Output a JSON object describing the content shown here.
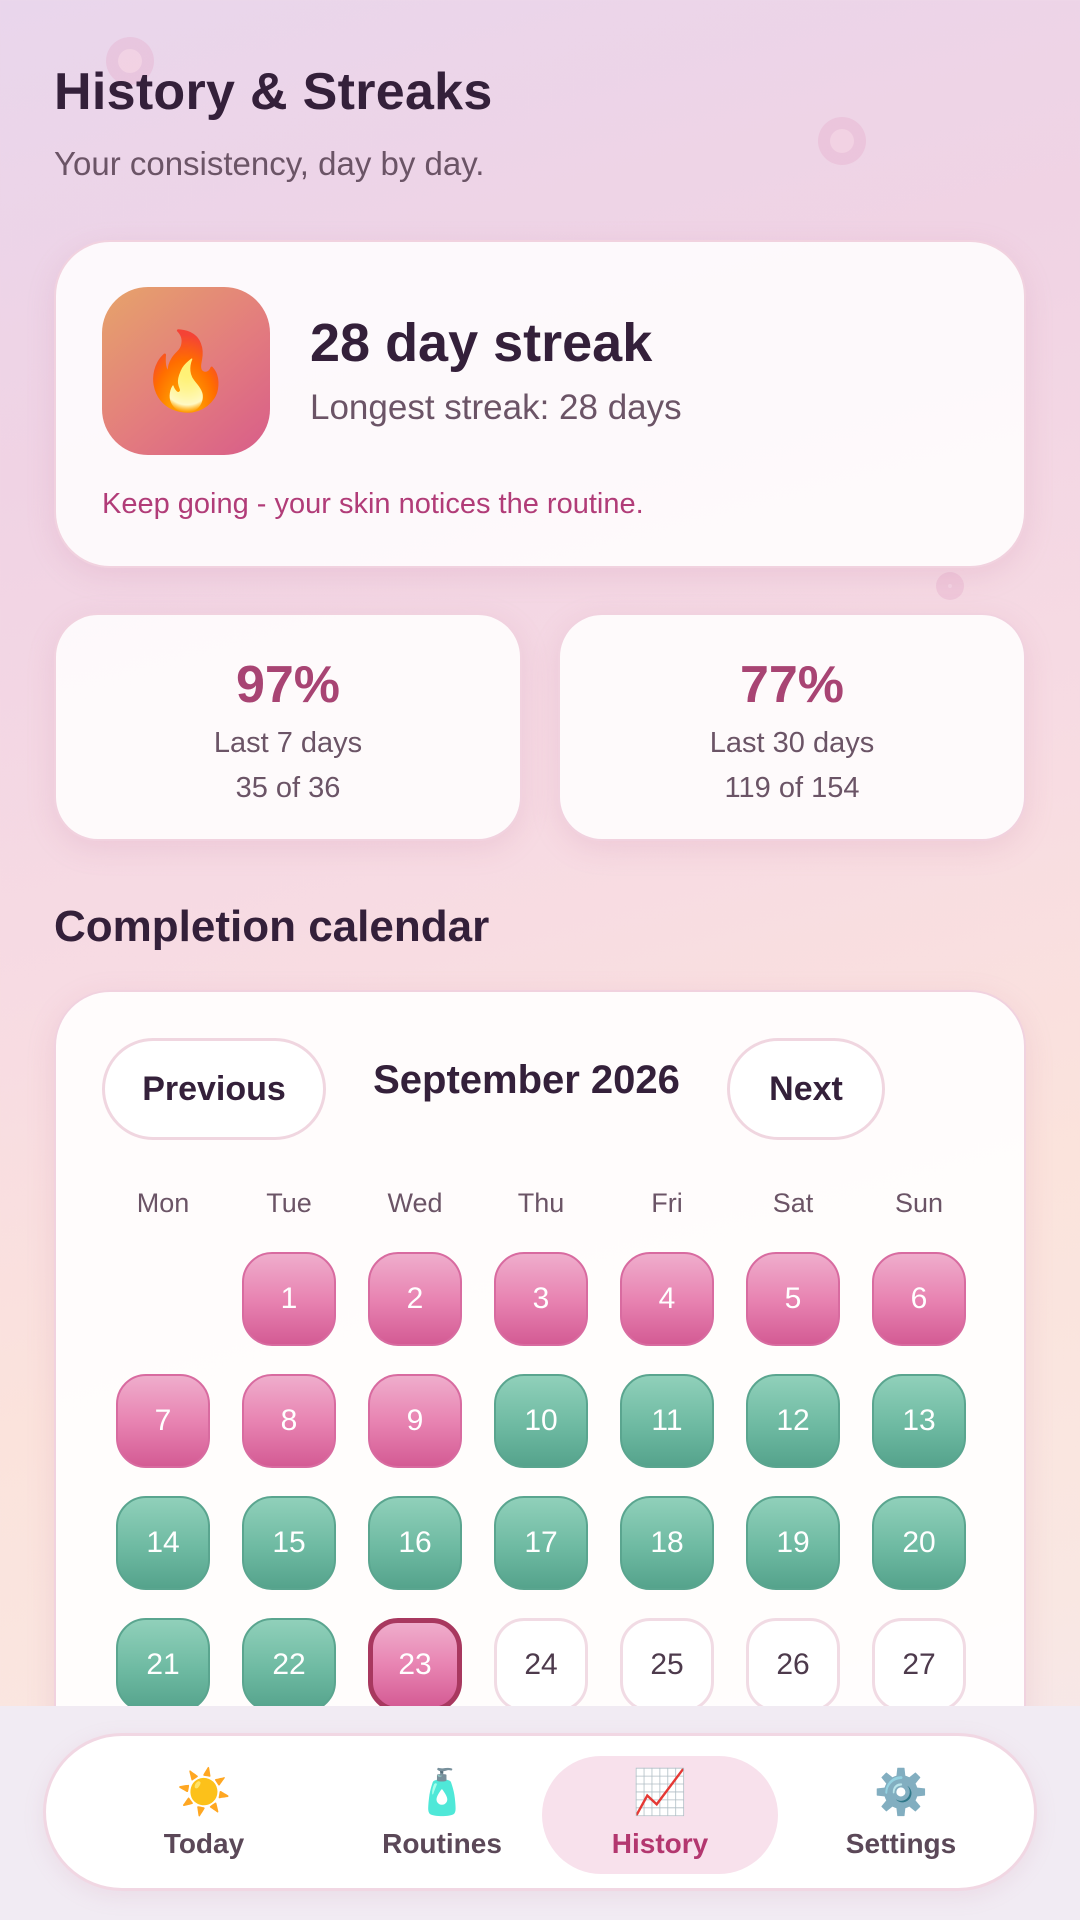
{
  "header": {
    "title": "History & Streaks",
    "subtitle": "Your consistency, day by day."
  },
  "streak": {
    "icon": "flame-icon",
    "icon_glyph": "🔥",
    "title": "28 day streak",
    "longest": "Longest streak: 28 days",
    "message": "Keep going - your skin notices the routine."
  },
  "stats": [
    {
      "percent": "97%",
      "label": "Last 7 days",
      "count": "35 of 36"
    },
    {
      "percent": "77%",
      "label": "Last 30 days",
      "count": "119 of 154"
    }
  ],
  "calendar": {
    "section_title": "Completion calendar",
    "prev_label": "Previous",
    "next_label": "Next",
    "month": "September 2026",
    "weekdays": [
      "Mon",
      "Tue",
      "Wed",
      "Thu",
      "Fri",
      "Sat",
      "Sun"
    ],
    "status_colors": {
      "partial": "#e884b2",
      "complete": "#6ebaa2",
      "pending": "#ffffff"
    },
    "days": [
      {
        "day": "1",
        "status": "partial"
      },
      {
        "day": "2",
        "status": "partial"
      },
      {
        "day": "3",
        "status": "partial"
      },
      {
        "day": "4",
        "status": "partial"
      },
      {
        "day": "5",
        "status": "partial"
      },
      {
        "day": "6",
        "status": "partial"
      },
      {
        "day": "7",
        "status": "partial"
      },
      {
        "day": "8",
        "status": "partial"
      },
      {
        "day": "9",
        "status": "partial"
      },
      {
        "day": "10",
        "status": "complete"
      },
      {
        "day": "11",
        "status": "complete"
      },
      {
        "day": "12",
        "status": "complete"
      },
      {
        "day": "13",
        "status": "complete"
      },
      {
        "day": "14",
        "status": "complete"
      },
      {
        "day": "15",
        "status": "complete"
      },
      {
        "day": "16",
        "status": "complete"
      },
      {
        "day": "17",
        "status": "complete"
      },
      {
        "day": "18",
        "status": "complete"
      },
      {
        "day": "19",
        "status": "complete"
      },
      {
        "day": "20",
        "status": "complete"
      },
      {
        "day": "21",
        "status": "complete"
      },
      {
        "day": "22",
        "status": "complete"
      },
      {
        "day": "23",
        "status": "partial",
        "today": true
      },
      {
        "day": "24",
        "status": "pending"
      },
      {
        "day": "25",
        "status": "pending"
      },
      {
        "day": "26",
        "status": "pending"
      },
      {
        "day": "27",
        "status": "pending"
      }
    ]
  },
  "nav": {
    "items": [
      {
        "label": "Today",
        "icon": "sun-icon",
        "glyph": "☀️",
        "active": false
      },
      {
        "label": "Routines",
        "icon": "lotion-bottle-icon",
        "glyph": "🧴",
        "active": false
      },
      {
        "label": "History",
        "icon": "chart-icon",
        "glyph": "📈",
        "active": true
      },
      {
        "label": "Settings",
        "icon": "gear-icon",
        "glyph": "⚙️",
        "active": false
      }
    ]
  }
}
